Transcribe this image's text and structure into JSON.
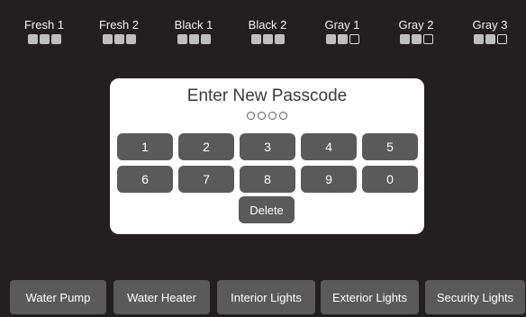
{
  "tanks": [
    {
      "label": "Fresh 1",
      "level": [
        true,
        true,
        true
      ]
    },
    {
      "label": "Fresh 2",
      "level": [
        true,
        true,
        true
      ]
    },
    {
      "label": "Black 1",
      "level": [
        true,
        true,
        true
      ]
    },
    {
      "label": "Black 2",
      "level": [
        true,
        true,
        true
      ]
    },
    {
      "label": "Gray 1",
      "level": [
        true,
        true,
        false
      ]
    },
    {
      "label": "Gray 2",
      "level": [
        true,
        true,
        false
      ]
    },
    {
      "label": "Gray 3",
      "level": [
        true,
        true,
        false
      ]
    }
  ],
  "passcode": {
    "title": "Enter New Passcode",
    "digits_entered": 0,
    "digits_total": 4,
    "keys": [
      "1",
      "2",
      "3",
      "4",
      "5",
      "6",
      "7",
      "8",
      "9",
      "0"
    ],
    "delete_label": "Delete"
  },
  "bottom_bar": [
    {
      "label": "Water Pump"
    },
    {
      "label": "Water Heater"
    },
    {
      "label": "Interior Lights"
    },
    {
      "label": "Exterior Lights"
    },
    {
      "label": "Security Lights"
    }
  ],
  "colors": {
    "background": "#231f20",
    "button": "#5a5a5a",
    "modal": "#ffffff",
    "tank_fill": "#bfbfbf"
  }
}
